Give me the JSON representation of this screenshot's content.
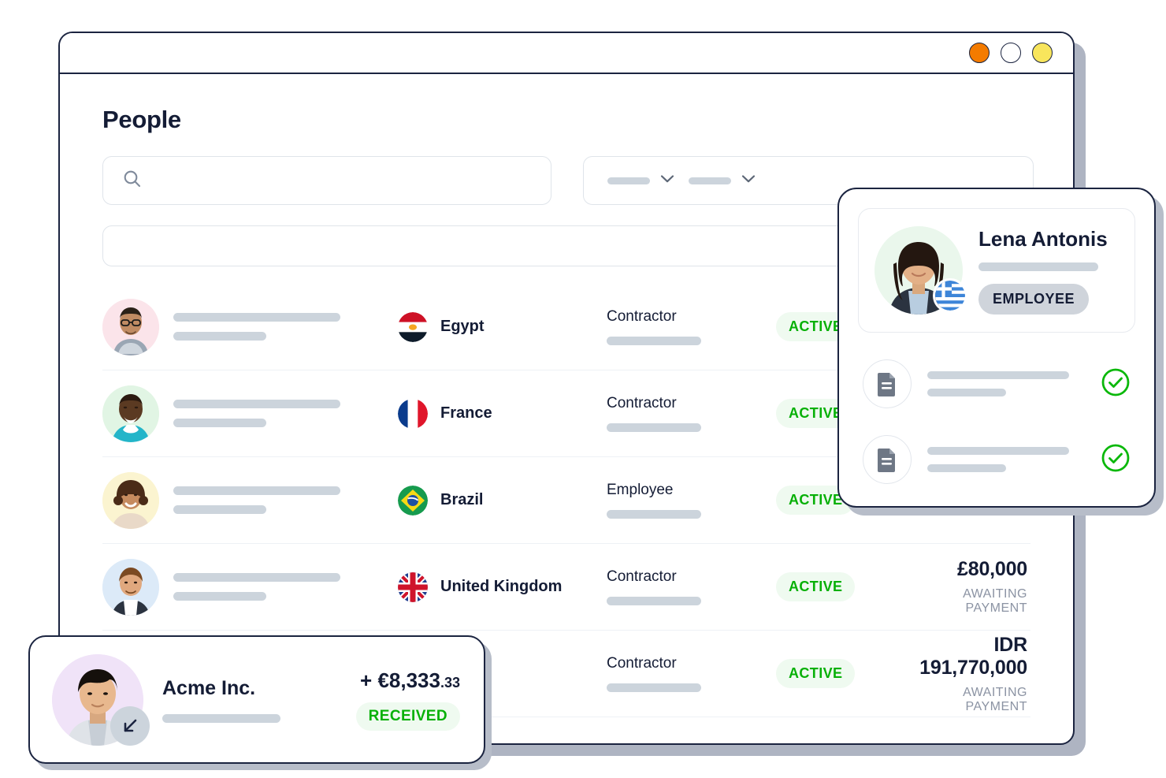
{
  "window": {
    "dots": [
      {
        "name": "window-dot-orange",
        "color": "#f47b00"
      },
      {
        "name": "window-dot-white",
        "color": "#ffffff"
      },
      {
        "name": "window-dot-yellow",
        "color": "#f8e55c"
      }
    ]
  },
  "page": {
    "title": "People"
  },
  "search": {
    "value": "",
    "placeholder": "",
    "icon": "search-icon"
  },
  "filters": {
    "chips": [
      {
        "icon": "chevron-down-icon"
      },
      {
        "icon": "chevron-down-icon"
      }
    ]
  },
  "table": {
    "rows": [
      {
        "avatar_bg": "#fbe4ea",
        "country": "Egypt",
        "flag": "egypt-flag-icon",
        "type": "Contractor",
        "status": "ACTIVE",
        "amount": "",
        "amount_sub": ""
      },
      {
        "avatar_bg": "#e1f5e4",
        "country": "France",
        "flag": "france-flag-icon",
        "type": "Contractor",
        "status": "ACTIVE",
        "amount": "",
        "amount_sub": ""
      },
      {
        "avatar_bg": "#fbf4d0",
        "country": "Brazil",
        "flag": "brazil-flag-icon",
        "type": "Employee",
        "status": "ACTIVE",
        "amount": "",
        "amount_sub": ""
      },
      {
        "avatar_bg": "#dceaf8",
        "country": "United Kingdom",
        "flag": "united-kingdom-flag-icon",
        "type": "Contractor",
        "status": "ACTIVE",
        "amount": "£80,000",
        "amount_sub": "AWAITING PAYMENT"
      },
      {
        "avatar_bg": "#f0e3f8",
        "country": "",
        "flag": "",
        "type": "Contractor",
        "status": "ACTIVE",
        "amount": "IDR  191,770,000",
        "amount_sub": "AWAITING PAYMENT"
      }
    ]
  },
  "lena_card": {
    "name": "Lena Antonis",
    "flag": "greece-flag-icon",
    "badge": "EMPLOYEE",
    "documents": [
      {
        "icon": "document-icon",
        "status_icon": "check-circle-icon"
      },
      {
        "icon": "document-icon",
        "status_icon": "check-circle-icon"
      }
    ]
  },
  "acme_card": {
    "name": "Acme Inc.",
    "amount_main": "+ €8,333",
    "amount_cents": ".33",
    "badge": "RECEIVED",
    "arrow_icon": "arrow-down-left-icon"
  },
  "colors": {
    "accent_green": "#07b007",
    "green_bg": "#effaf0",
    "ink": "#141c35",
    "border": "#1b2440",
    "skeleton": "#ccd4dc",
    "shadow": "#b7bdc9"
  }
}
